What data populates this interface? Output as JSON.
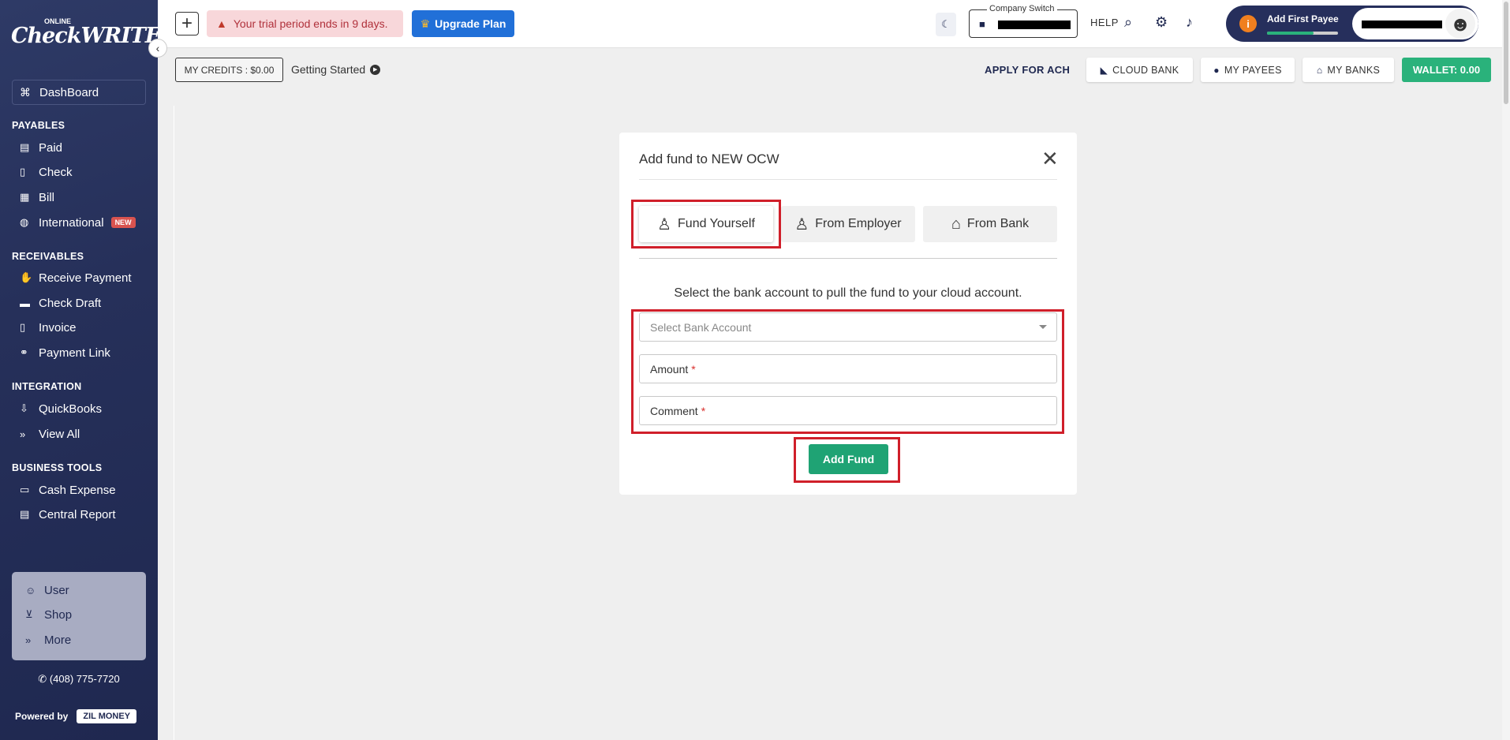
{
  "sidebar": {
    "logo_small": "ONLINE",
    "logo_big": "CheckWRITER",
    "dashboard": "DashBoard",
    "sections": {
      "payables": "PAYABLES",
      "receivables": "RECEIVABLES",
      "integration": "INTEGRATION",
      "business_tools": "BUSINESS TOOLS"
    },
    "payables": [
      "Paid",
      "Check",
      "Bill",
      "International"
    ],
    "international_badge": "NEW",
    "receivables": [
      "Receive Payment",
      "Check Draft",
      "Invoice",
      "Payment Link"
    ],
    "integration": [
      "QuickBooks",
      "View All"
    ],
    "business_tools": [
      "Cash Expense",
      "Central Report"
    ],
    "box": [
      "User",
      "Shop",
      "More"
    ],
    "phone": "(408) 775-7720",
    "powered_by": "Powered by",
    "zil": "ZIL MONEY"
  },
  "topbar": {
    "trial": "Your trial period ends in 9 days.",
    "upgrade": "Upgrade Plan",
    "company_switch_label": "Company Switch",
    "help": "HELP",
    "add_first_payee": "Add First Payee",
    "payee_progress": 0.65
  },
  "subbar": {
    "credits": "MY CREDITS : $0.00",
    "getting_started": "Getting Started",
    "apply_ach": "APPLY FOR ACH",
    "cloud_bank": "CLOUD BANK",
    "my_payees": "MY PAYEES",
    "my_banks": "MY BANKS",
    "wallet": "WALLET: 0.00"
  },
  "modal": {
    "title": "Add fund to NEW OCW",
    "tabs": [
      "Fund Yourself",
      "From Employer",
      "From Bank"
    ],
    "description": "Select the bank account to pull the fund to your cloud account.",
    "bank_placeholder": "Select Bank Account",
    "amount_label": "Amount",
    "comment_label": "Comment",
    "required_mark": "*",
    "submit": "Add Fund"
  },
  "colors": {
    "sidebar": "#26305a",
    "primary": "#2170d8",
    "success": "#2ab27b",
    "highlight": "#d01f2a"
  }
}
